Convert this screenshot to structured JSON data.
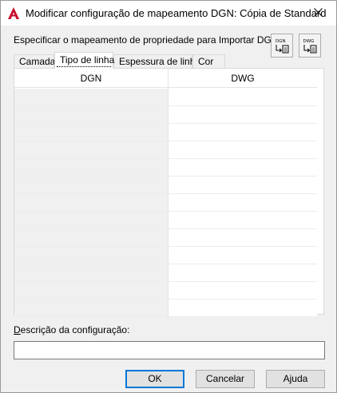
{
  "window": {
    "title": "Modificar configuração de mapeamento DGN: Cópia de Standard"
  },
  "instruction": "Especificar o mapeamento de propriedade para Importar DGN",
  "map_buttons": [
    {
      "label": "DGN",
      "icon": "dgn-to-dwg-icon"
    },
    {
      "label": "DWG",
      "icon": "dwg-to-dgn-icon"
    }
  ],
  "tabs": [
    {
      "label": "Camada",
      "active": false
    },
    {
      "label": "Tipo de linha",
      "active": true
    },
    {
      "label": "Espessura de linha",
      "active": false
    },
    {
      "label": "Cor",
      "active": false
    }
  ],
  "grid": {
    "columns": [
      "DGN",
      "DWG"
    ],
    "rows": [
      [
        "",
        ""
      ],
      [
        "",
        ""
      ],
      [
        "",
        ""
      ],
      [
        "",
        ""
      ],
      [
        "",
        ""
      ],
      [
        "",
        ""
      ],
      [
        "",
        ""
      ],
      [
        "",
        ""
      ],
      [
        "",
        ""
      ],
      [
        "",
        ""
      ],
      [
        "",
        ""
      ],
      [
        "",
        ""
      ],
      [
        "",
        ""
      ]
    ]
  },
  "description": {
    "label": "Descrição da configuração:",
    "value": ""
  },
  "buttons": {
    "ok": "OK",
    "cancel": "Cancelar",
    "help": "Ajuda"
  },
  "colors": {
    "accent": "#0078d7",
    "app_icon": "#c8102e"
  }
}
